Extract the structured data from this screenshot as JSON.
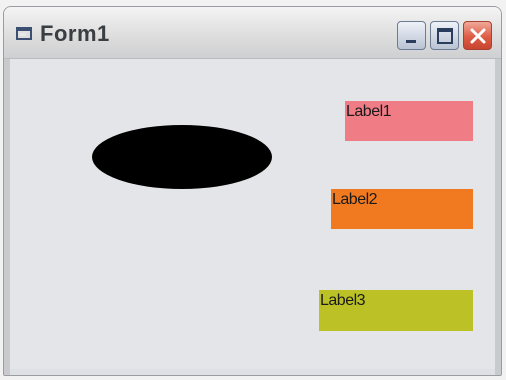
{
  "window": {
    "title": "Form1",
    "controls": {
      "minimize_icon": "minimize-icon",
      "maximize_icon": "maximize-icon",
      "close_icon": "close-icon"
    }
  },
  "form": {
    "shape": {
      "type": "ellipse",
      "fill": "#000000"
    },
    "labels": [
      {
        "text": "Label1",
        "color": "#f07c86"
      },
      {
        "text": "Label2",
        "color": "#f17a21"
      },
      {
        "text": "Label3",
        "color": "#bcc226"
      }
    ]
  },
  "colors": {
    "client_background": "#e4e5e8",
    "close_button": "#de5c45"
  }
}
